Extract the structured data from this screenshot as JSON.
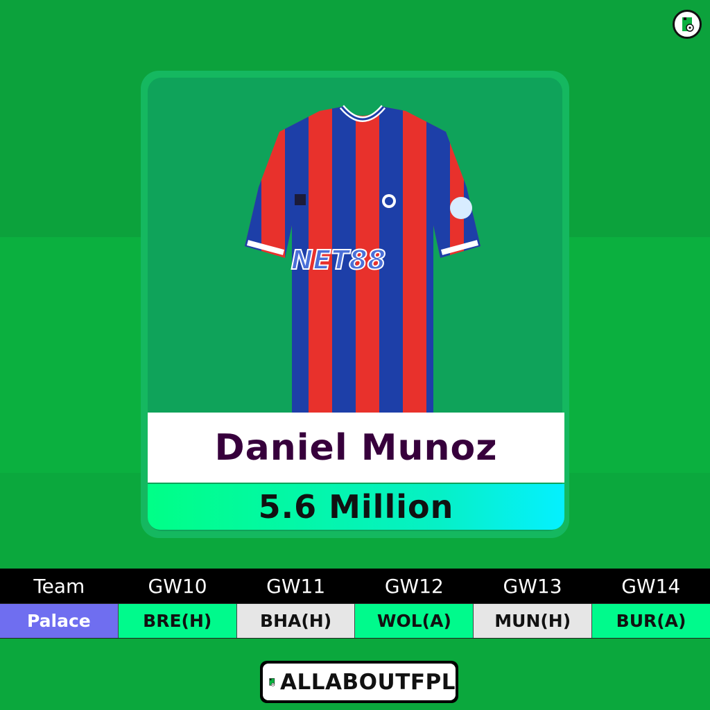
{
  "player": {
    "name": "Daniel Munoz",
    "price": "5.6 Million",
    "shirt_sponsor": "NET88"
  },
  "fixtures": {
    "headers": [
      "Team",
      "GW10",
      "GW11",
      "GW12",
      "GW13",
      "GW14"
    ],
    "team": "Palace",
    "games": [
      "BRE(H)",
      "BHA(H)",
      "WOL(A)",
      "MUN(H)",
      "BUR(A)"
    ]
  },
  "brand": {
    "name": "ALLABOUTFPL"
  },
  "colors": {
    "team_cell": "#6f6ef0",
    "easy_fixture": "#00fa8c",
    "neutral_fixture": "#e6e6e6"
  }
}
